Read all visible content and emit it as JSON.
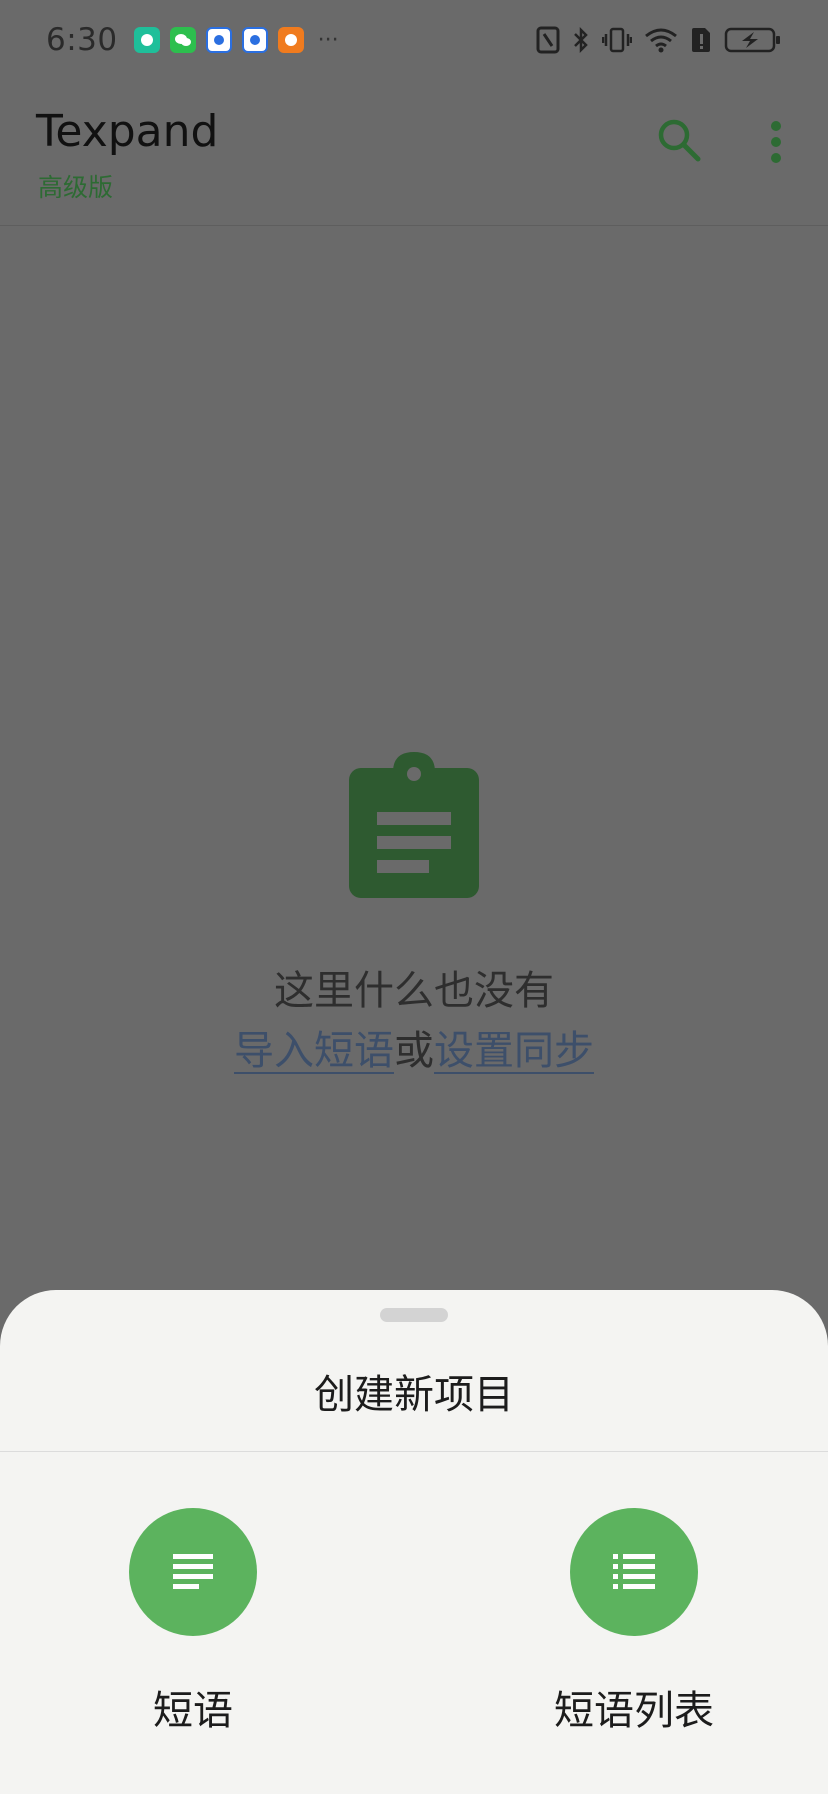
{
  "status_bar": {
    "time": "6:30",
    "more": "···",
    "notification_icons": [
      {
        "name": "contacts-app-icon",
        "color": "#1fbf9a"
      },
      {
        "name": "wechat-icon",
        "color": "#2dbf4e"
      },
      {
        "name": "blue-app-icon-1",
        "color": "#2b6fe0"
      },
      {
        "name": "blue-app-icon-2",
        "color": "#2b6fe0"
      },
      {
        "name": "orange-app-icon",
        "color": "#f07b1e"
      }
    ],
    "system_icons": [
      "nfc-icon",
      "bluetooth-icon",
      "vibrate-icon",
      "wifi-icon",
      "sim-alert-icon",
      "battery-charging-icon"
    ]
  },
  "app_bar": {
    "title": "Texpand",
    "subtitle": "高级版",
    "search_icon": "search-icon",
    "menu_icon": "more-vert-icon"
  },
  "empty_state": {
    "icon": "clipboard-icon",
    "message": "这里什么也没有",
    "import_link": "导入短语",
    "separator": "或",
    "sync_link": "设置同步"
  },
  "sheet": {
    "title": "创建新项目",
    "options": [
      {
        "label": "短语",
        "icon": "notes-icon"
      },
      {
        "label": "短语列表",
        "icon": "list-icon"
      }
    ]
  },
  "colors": {
    "accent_green": "#5cb35e",
    "dark_green": "#2d6b33",
    "scrim": "#6a6a6a",
    "sheet_bg": "#f4f4f2"
  }
}
